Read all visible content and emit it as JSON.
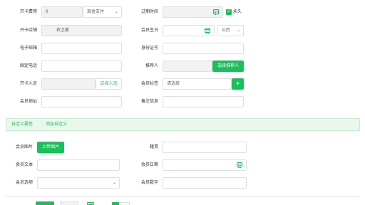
{
  "form": {
    "card_fee": {
      "label": "开卡费用",
      "value": "0",
      "payment": "现金支付"
    },
    "expire": {
      "label": "过期时间",
      "value": "",
      "forever_label": "永久",
      "forever_checked": true
    },
    "store": {
      "label": "开卡店铺",
      "value": "衣之家"
    },
    "birthday": {
      "label": "会员生日",
      "value": "",
      "calendar_type": "公历"
    },
    "email": {
      "label": "电子邮箱",
      "value": ""
    },
    "id_no": {
      "label": "身份证号",
      "value": ""
    },
    "phone": {
      "label": "固定电话",
      "value": ""
    },
    "referrer": {
      "label": "推荐人",
      "value": "",
      "button": "选择推荐人"
    },
    "opener": {
      "label": "开卡人员",
      "value": "",
      "button": "选择人员"
    },
    "tags": {
      "label": "会员标签",
      "placeholder": "请选择",
      "add_icon": "plus-icon"
    },
    "address": {
      "label": "会员地址",
      "value": ""
    },
    "remark": {
      "label": "备注信息",
      "value": ""
    }
  },
  "custom_section": {
    "title": "自定义属性",
    "add_link": "添加自定义"
  },
  "custom_fields": {
    "image": {
      "label": "会员图片",
      "button": "上传图片"
    },
    "hobby": {
      "label": "籍贯",
      "value": ""
    },
    "text": {
      "label": "会员文本",
      "value": ""
    },
    "date": {
      "label": "会员日期",
      "value": ""
    },
    "option": {
      "label": "会员选项",
      "value": ""
    },
    "number": {
      "label": "会员数字",
      "value": ""
    }
  },
  "colors": {
    "accent": "#1bbf5c",
    "section_bg": "#eaf8ec"
  }
}
